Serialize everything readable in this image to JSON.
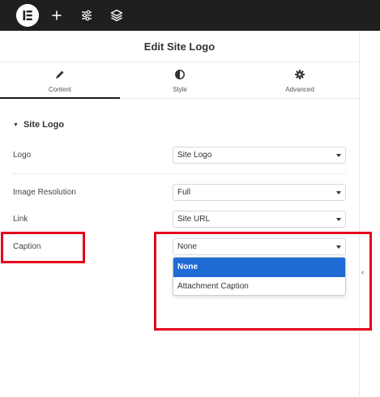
{
  "topbar": {
    "icons": [
      "elementor-logo-icon",
      "plus-icon",
      "sliders-icon",
      "layers-icon"
    ]
  },
  "panel": {
    "title": "Edit Site Logo"
  },
  "tabs": [
    {
      "label": "Content",
      "icon": "pencil-icon",
      "active": true
    },
    {
      "label": "Style",
      "icon": "half-circle-icon",
      "active": false
    },
    {
      "label": "Advanced",
      "icon": "gear-icon",
      "active": false
    }
  ],
  "section": {
    "title": "Site Logo"
  },
  "controls": {
    "logo": {
      "label": "Logo",
      "value": "Site Logo"
    },
    "resolution": {
      "label": "Image Resolution",
      "value": "Full"
    },
    "link": {
      "label": "Link",
      "value": "Site URL"
    },
    "caption": {
      "label": "Caption",
      "value": "None",
      "options": [
        "None",
        "Attachment Caption"
      ]
    }
  },
  "colors": {
    "topbar": "#1f1f1f",
    "selected_option": "#1e6bd6",
    "highlight": "#e3001b"
  }
}
